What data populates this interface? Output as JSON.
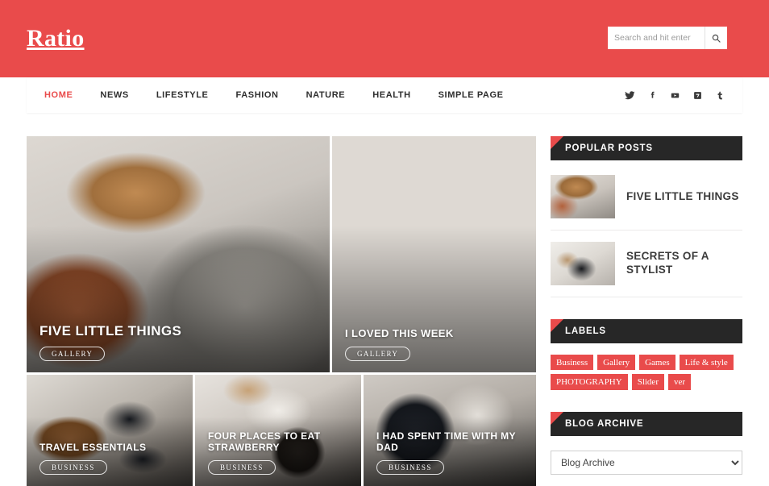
{
  "site": {
    "logo": "Ratio",
    "accent_color": "#e94b4b",
    "header_bar_color": "#272727"
  },
  "search": {
    "placeholder": "Search and hit enter",
    "value": "",
    "icon": "search-icon"
  },
  "nav": {
    "items": [
      {
        "label": "HOME",
        "active": true
      },
      {
        "label": "NEWS",
        "active": false
      },
      {
        "label": "LIFESTYLE",
        "active": false
      },
      {
        "label": "FASHION",
        "active": false
      },
      {
        "label": "NATURE",
        "active": false
      },
      {
        "label": "HEALTH",
        "active": false
      },
      {
        "label": "SIMPLE PAGE",
        "active": false
      }
    ],
    "social": [
      {
        "name": "twitter-icon",
        "label": "Twitter"
      },
      {
        "name": "facebook-icon",
        "label": "Facebook"
      },
      {
        "name": "youtube-icon",
        "label": "YouTube"
      },
      {
        "name": "vimeo-icon",
        "label": "Vimeo"
      },
      {
        "name": "tumblr-icon",
        "label": "Tumblr"
      }
    ]
  },
  "featured": {
    "hero": {
      "title": "FIVE LITTLE THINGS",
      "badge": "GALLERY"
    },
    "top_right": {
      "title": "I LOVED THIS WEEK",
      "badge": "GALLERY"
    },
    "bottom": [
      {
        "title": "TRAVEL ESSENTIALS",
        "badge": "BUSINESS"
      },
      {
        "title": "FOUR PLACES TO EAT STRAWBERRY",
        "badge": "BUSINESS"
      },
      {
        "title": "I HAD SPENT TIME WITH MY DAD",
        "badge": "BUSINESS"
      }
    ]
  },
  "sidebar": {
    "popular": {
      "title": "POPULAR POSTS",
      "items": [
        {
          "title": "FIVE LITTLE THINGS"
        },
        {
          "title": "SECRETS OF A STYLIST"
        }
      ]
    },
    "labels": {
      "title": "LABELS",
      "items": [
        "Business",
        "Gallery",
        "Games",
        "Life & style",
        "PHOTOGRAPHY",
        "Slider",
        "ver"
      ]
    },
    "archive": {
      "title": "BLOG ARCHIVE",
      "selected": "Blog Archive"
    }
  }
}
